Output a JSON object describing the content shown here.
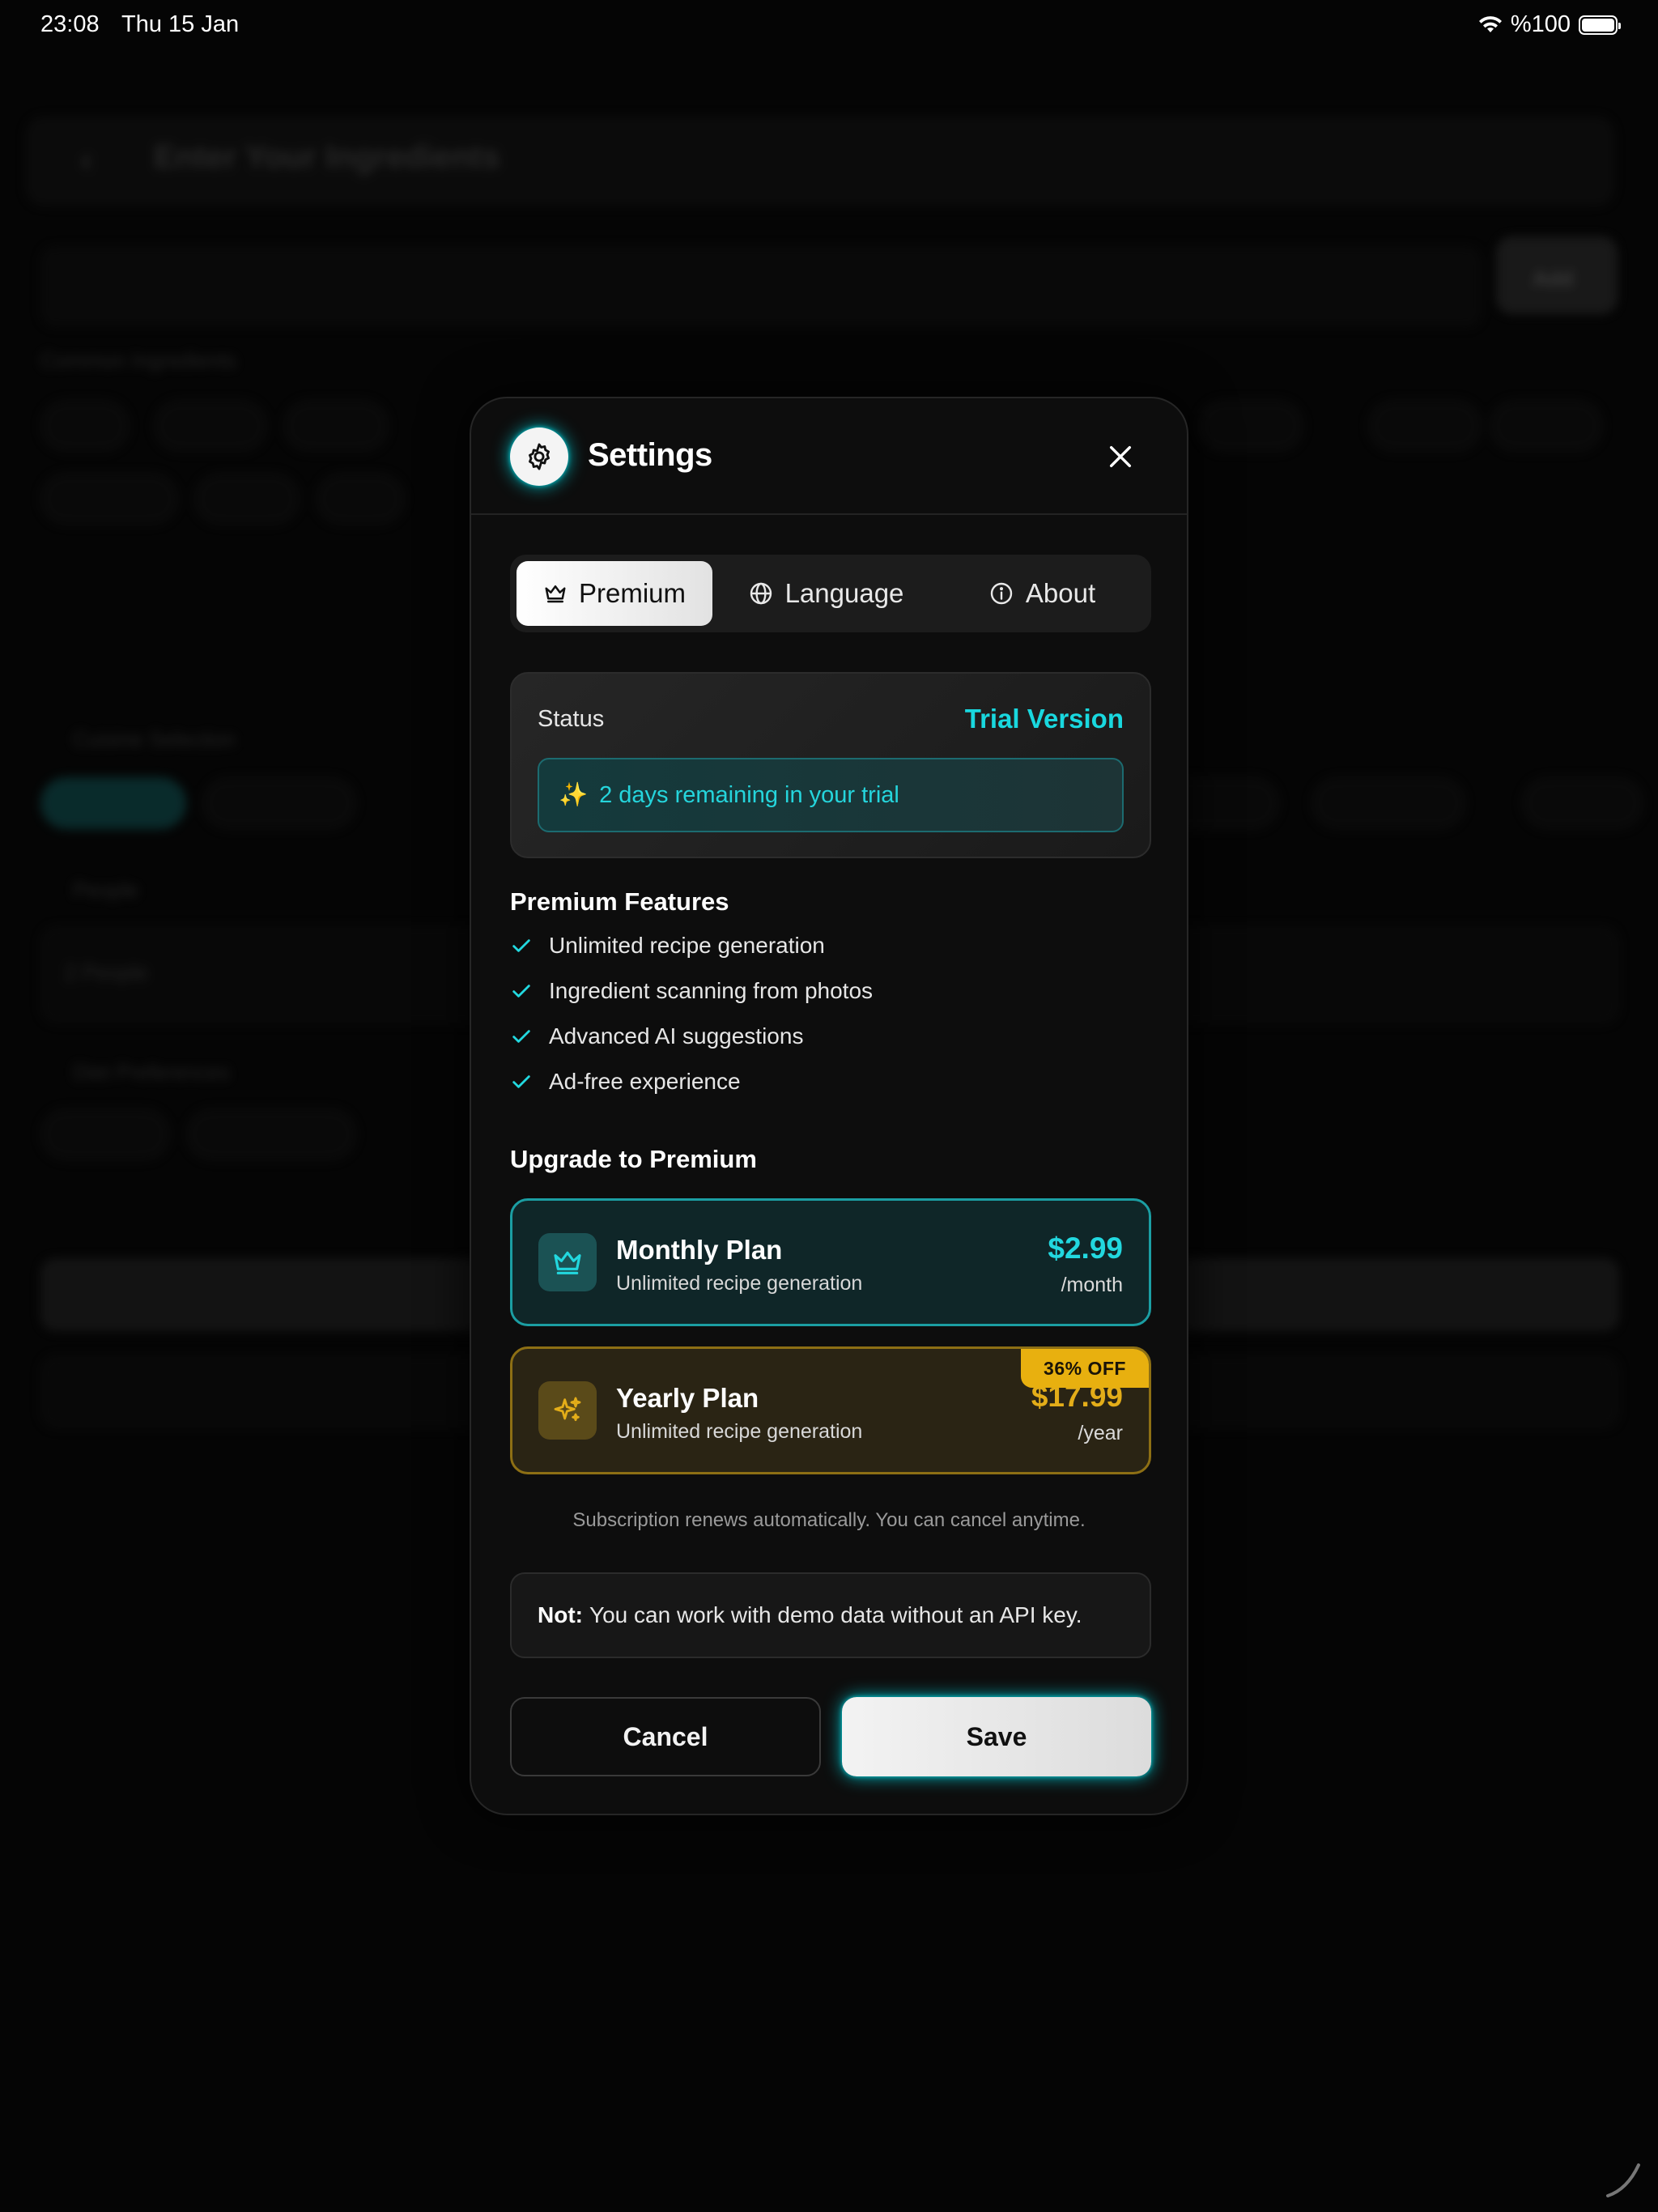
{
  "status_bar": {
    "time": "23:08",
    "date": "Thu 15 Jan",
    "battery": "%100"
  },
  "background_app": {
    "title": "Enter Your Ingredients",
    "add_button": "Add",
    "section_common": "Common Ingredients",
    "section_cuisine": "Cuisine Selection",
    "section_people": "People",
    "people_value": "2 People",
    "section_diet": "Diet Preferences"
  },
  "modal": {
    "title": "Settings",
    "tabs": [
      {
        "label": "Premium",
        "icon": "crown-icon"
      },
      {
        "label": "Language",
        "icon": "globe-icon"
      },
      {
        "label": "About",
        "icon": "info-icon"
      }
    ],
    "status": {
      "label": "Status",
      "value": "Trial Version",
      "trial_emoji": "✨",
      "trial_message": "2 days remaining in your trial"
    },
    "features_title": "Premium Features",
    "features": [
      "Unlimited recipe generation",
      "Ingredient scanning from photos",
      "Advanced AI suggestions",
      "Ad-free experience"
    ],
    "upgrade_title": "Upgrade to Premium",
    "plans": {
      "monthly": {
        "name": "Monthly Plan",
        "description": "Unlimited recipe generation",
        "price": "$2.99",
        "period": "/month",
        "icon": "crown-icon"
      },
      "yearly": {
        "name": "Yearly Plan",
        "description": "Unlimited recipe generation",
        "price": "$17.99",
        "period": "/year",
        "badge": "36% OFF",
        "icon": "sparkles-icon"
      }
    },
    "renew_note": "Subscription renews automatically. You can cancel anytime.",
    "note_label": "Not:",
    "note_text": "You can work with demo data without an API key.",
    "cancel_label": "Cancel",
    "save_label": "Save"
  },
  "colors": {
    "accent": "#19d8df",
    "gold": "#e8b00f",
    "background": "#050505",
    "modal": "#0d0d0d"
  }
}
